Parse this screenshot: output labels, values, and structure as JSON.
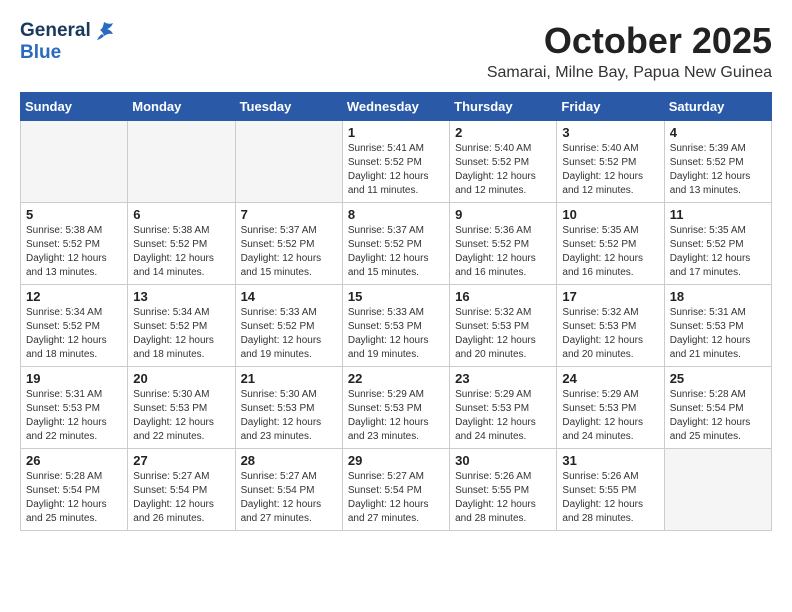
{
  "header": {
    "logo": {
      "line1": "General",
      "line2": "Blue"
    },
    "month": "October 2025",
    "location": "Samarai, Milne Bay, Papua New Guinea"
  },
  "calendar": {
    "days_of_week": [
      "Sunday",
      "Monday",
      "Tuesday",
      "Wednesday",
      "Thursday",
      "Friday",
      "Saturday"
    ],
    "weeks": [
      [
        {
          "day": "",
          "detail": ""
        },
        {
          "day": "",
          "detail": ""
        },
        {
          "day": "",
          "detail": ""
        },
        {
          "day": "1",
          "detail": "Sunrise: 5:41 AM\nSunset: 5:52 PM\nDaylight: 12 hours\nand 11 minutes."
        },
        {
          "day": "2",
          "detail": "Sunrise: 5:40 AM\nSunset: 5:52 PM\nDaylight: 12 hours\nand 12 minutes."
        },
        {
          "day": "3",
          "detail": "Sunrise: 5:40 AM\nSunset: 5:52 PM\nDaylight: 12 hours\nand 12 minutes."
        },
        {
          "day": "4",
          "detail": "Sunrise: 5:39 AM\nSunset: 5:52 PM\nDaylight: 12 hours\nand 13 minutes."
        }
      ],
      [
        {
          "day": "5",
          "detail": "Sunrise: 5:38 AM\nSunset: 5:52 PM\nDaylight: 12 hours\nand 13 minutes."
        },
        {
          "day": "6",
          "detail": "Sunrise: 5:38 AM\nSunset: 5:52 PM\nDaylight: 12 hours\nand 14 minutes."
        },
        {
          "day": "7",
          "detail": "Sunrise: 5:37 AM\nSunset: 5:52 PM\nDaylight: 12 hours\nand 15 minutes."
        },
        {
          "day": "8",
          "detail": "Sunrise: 5:37 AM\nSunset: 5:52 PM\nDaylight: 12 hours\nand 15 minutes."
        },
        {
          "day": "9",
          "detail": "Sunrise: 5:36 AM\nSunset: 5:52 PM\nDaylight: 12 hours\nand 16 minutes."
        },
        {
          "day": "10",
          "detail": "Sunrise: 5:35 AM\nSunset: 5:52 PM\nDaylight: 12 hours\nand 16 minutes."
        },
        {
          "day": "11",
          "detail": "Sunrise: 5:35 AM\nSunset: 5:52 PM\nDaylight: 12 hours\nand 17 minutes."
        }
      ],
      [
        {
          "day": "12",
          "detail": "Sunrise: 5:34 AM\nSunset: 5:52 PM\nDaylight: 12 hours\nand 18 minutes."
        },
        {
          "day": "13",
          "detail": "Sunrise: 5:34 AM\nSunset: 5:52 PM\nDaylight: 12 hours\nand 18 minutes."
        },
        {
          "day": "14",
          "detail": "Sunrise: 5:33 AM\nSunset: 5:52 PM\nDaylight: 12 hours\nand 19 minutes."
        },
        {
          "day": "15",
          "detail": "Sunrise: 5:33 AM\nSunset: 5:53 PM\nDaylight: 12 hours\nand 19 minutes."
        },
        {
          "day": "16",
          "detail": "Sunrise: 5:32 AM\nSunset: 5:53 PM\nDaylight: 12 hours\nand 20 minutes."
        },
        {
          "day": "17",
          "detail": "Sunrise: 5:32 AM\nSunset: 5:53 PM\nDaylight: 12 hours\nand 20 minutes."
        },
        {
          "day": "18",
          "detail": "Sunrise: 5:31 AM\nSunset: 5:53 PM\nDaylight: 12 hours\nand 21 minutes."
        }
      ],
      [
        {
          "day": "19",
          "detail": "Sunrise: 5:31 AM\nSunset: 5:53 PM\nDaylight: 12 hours\nand 22 minutes."
        },
        {
          "day": "20",
          "detail": "Sunrise: 5:30 AM\nSunset: 5:53 PM\nDaylight: 12 hours\nand 22 minutes."
        },
        {
          "day": "21",
          "detail": "Sunrise: 5:30 AM\nSunset: 5:53 PM\nDaylight: 12 hours\nand 23 minutes."
        },
        {
          "day": "22",
          "detail": "Sunrise: 5:29 AM\nSunset: 5:53 PM\nDaylight: 12 hours\nand 23 minutes."
        },
        {
          "day": "23",
          "detail": "Sunrise: 5:29 AM\nSunset: 5:53 PM\nDaylight: 12 hours\nand 24 minutes."
        },
        {
          "day": "24",
          "detail": "Sunrise: 5:29 AM\nSunset: 5:53 PM\nDaylight: 12 hours\nand 24 minutes."
        },
        {
          "day": "25",
          "detail": "Sunrise: 5:28 AM\nSunset: 5:54 PM\nDaylight: 12 hours\nand 25 minutes."
        }
      ],
      [
        {
          "day": "26",
          "detail": "Sunrise: 5:28 AM\nSunset: 5:54 PM\nDaylight: 12 hours\nand 25 minutes."
        },
        {
          "day": "27",
          "detail": "Sunrise: 5:27 AM\nSunset: 5:54 PM\nDaylight: 12 hours\nand 26 minutes."
        },
        {
          "day": "28",
          "detail": "Sunrise: 5:27 AM\nSunset: 5:54 PM\nDaylight: 12 hours\nand 27 minutes."
        },
        {
          "day": "29",
          "detail": "Sunrise: 5:27 AM\nSunset: 5:54 PM\nDaylight: 12 hours\nand 27 minutes."
        },
        {
          "day": "30",
          "detail": "Sunrise: 5:26 AM\nSunset: 5:55 PM\nDaylight: 12 hours\nand 28 minutes."
        },
        {
          "day": "31",
          "detail": "Sunrise: 5:26 AM\nSunset: 5:55 PM\nDaylight: 12 hours\nand 28 minutes."
        },
        {
          "day": "",
          "detail": ""
        }
      ]
    ]
  }
}
